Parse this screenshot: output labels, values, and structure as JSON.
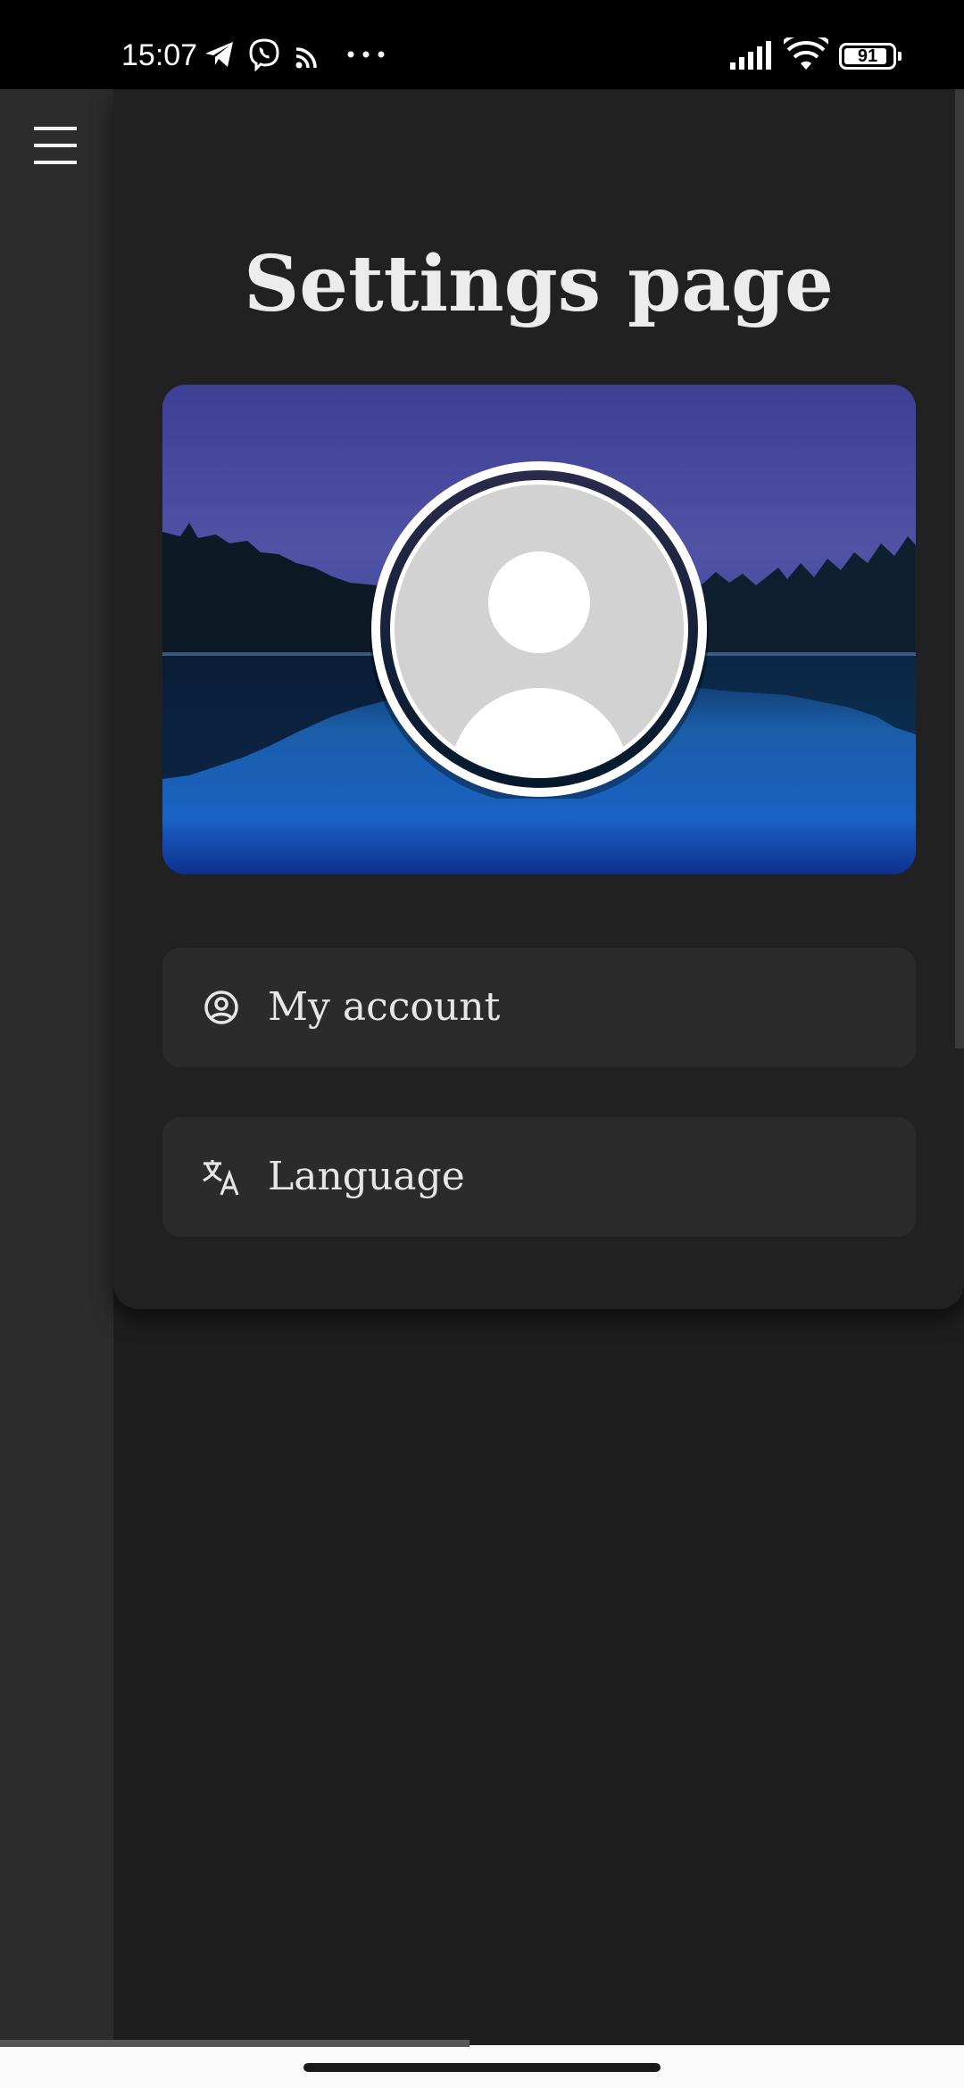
{
  "status_bar": {
    "time": "15:07",
    "battery": "91",
    "battery_level": 0.91,
    "icons": [
      "telegram-icon",
      "viber-icon",
      "rss-icon",
      "more-dots-icon",
      "signal-icon",
      "wifi-icon",
      "battery-icon"
    ]
  },
  "nav": {
    "menu_icon": "hamburger-menu-icon"
  },
  "page": {
    "title": "Settings page"
  },
  "menu": {
    "items": [
      {
        "label": "My account",
        "icon": "account-circle-icon"
      },
      {
        "label": "Language",
        "icon": "translate-icon"
      }
    ]
  },
  "colors": {
    "background": "#1e1e1e",
    "card": "#212121",
    "menu_item": "#2b2b2b",
    "rail": "#2c2c2c",
    "title_text": "#ececec"
  }
}
